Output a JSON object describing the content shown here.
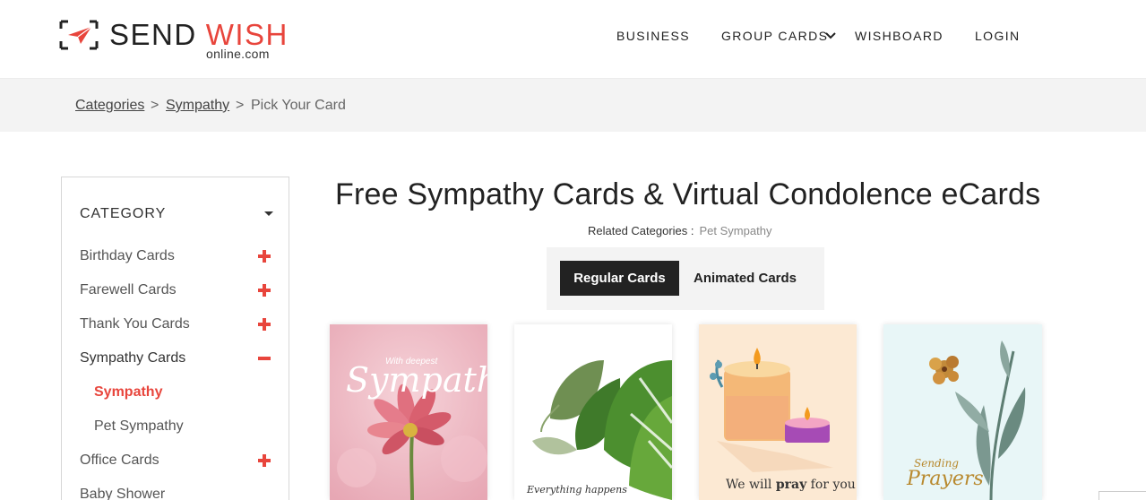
{
  "header": {
    "logo": {
      "primary": "SEND",
      "accent": "WISH",
      "sub": "online.com"
    },
    "nav": [
      "BUSINESS",
      "GROUP CARDS",
      "WISHBOARD",
      "LOGIN"
    ]
  },
  "breadcrumb": {
    "items": [
      "Categories",
      "Sympathy"
    ],
    "separator": ">",
    "current": "Pick Your Card"
  },
  "sidebar": {
    "heading": "CATEGORY",
    "items": [
      {
        "label": "Birthday Cards",
        "toggle": "plus"
      },
      {
        "label": "Farewell Cards",
        "toggle": "plus"
      },
      {
        "label": "Thank You Cards",
        "toggle": "plus"
      },
      {
        "label": "Sympathy Cards",
        "toggle": "minus"
      },
      {
        "label": "Office Cards",
        "toggle": "plus"
      },
      {
        "label": "Baby Shower",
        "toggle": "plus"
      }
    ],
    "sub_items": [
      {
        "label": "Sympathy",
        "current": true
      },
      {
        "label": "Pet Sympathy",
        "current": false
      }
    ]
  },
  "main": {
    "title": "Free Sympathy Cards & Virtual Condolence eCards",
    "related_label": "Related Categories :",
    "related_links": [
      "Pet Sympathy"
    ],
    "tabs": [
      {
        "label": "Regular Cards",
        "selected": true
      },
      {
        "label": "Animated Cards",
        "selected": false
      }
    ],
    "cards": [
      {
        "small": "With deepest",
        "script": "Sympathy",
        "icon": "pink-flower-icon"
      },
      {
        "text": "Everything happens",
        "icon": "monstera-leaf-icon"
      },
      {
        "text_pre": "We will ",
        "text_bold": "pray",
        "text_post": " for you",
        "icon": "candle-icon"
      },
      {
        "line1": "Sending",
        "line2": "Prayers",
        "icon": "lily-flower-icon"
      }
    ]
  },
  "colors": {
    "accent": "#e8453c",
    "dark": "#222222",
    "breadcrumb_bg": "#f3f3f3"
  }
}
